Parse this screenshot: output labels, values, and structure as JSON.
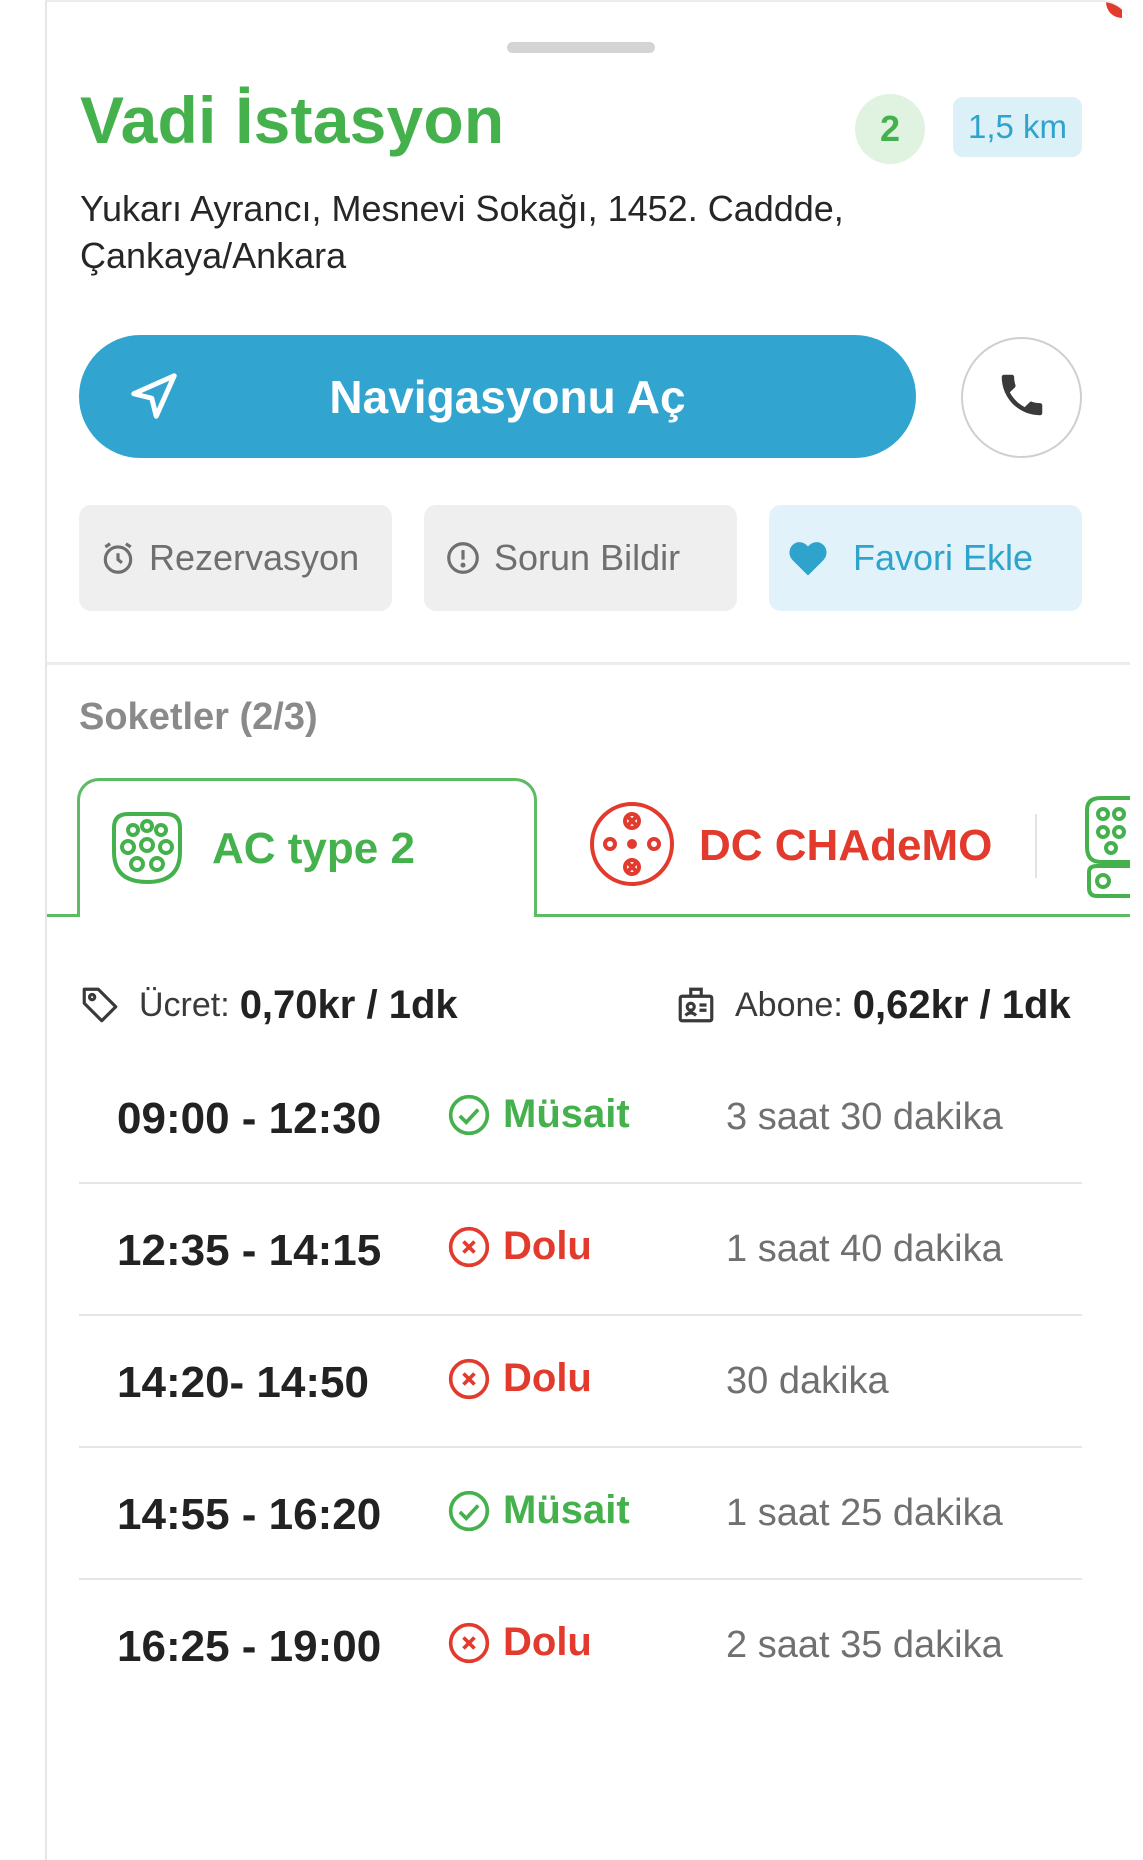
{
  "station": {
    "name": "Vadi İstasyon",
    "available_count": "2",
    "distance": "1,5 km",
    "address": "Yukarı Ayrancı, Mesnevi Sokağı, 1452. Caddde, Çankaya/Ankara"
  },
  "actions": {
    "navigate_label": "Navigasyonu Aç",
    "reservation_label": "Rezervasyon",
    "report_label": "Sorun Bildir",
    "favorite_label": "Favori Ekle"
  },
  "sockets": {
    "section_label": "Soketler (2/3)",
    "tabs": [
      {
        "label": "AC type 2",
        "icon": "ac-type2-plug-icon",
        "color": "#45b14d",
        "active": true
      },
      {
        "label": "DC CHAdeMO",
        "icon": "chademo-plug-icon",
        "color": "#e23b2e",
        "active": false
      },
      {
        "label": "",
        "icon": "ccs-plug-icon",
        "color": "#45b14d",
        "active": false
      }
    ]
  },
  "pricing": {
    "price_label": "Ücret:",
    "price_value": "0,70kr / 1dk",
    "subscriber_label": "Abone:",
    "subscriber_value": "0,62kr / 1dk"
  },
  "slots": [
    {
      "time": "09:00 - 12:30",
      "status": "Müsait",
      "duration": "3 saat 30 dakika"
    },
    {
      "time": "12:35 - 14:15",
      "status": "Dolu",
      "duration": "1 saat 40 dakika"
    },
    {
      "time": "14:20- 14:50",
      "status": "Dolu",
      "duration": "30 dakika"
    },
    {
      "time": "14:55 - 16:20",
      "status": "Müsait",
      "duration": "1 saat 25 dakika"
    },
    {
      "time": "16:25 - 19:00",
      "status": "Dolu",
      "duration": "2 saat 35 dakika"
    }
  ],
  "colors": {
    "green": "#45b14d",
    "blue": "#31a5d0",
    "red": "#e23b2e"
  }
}
